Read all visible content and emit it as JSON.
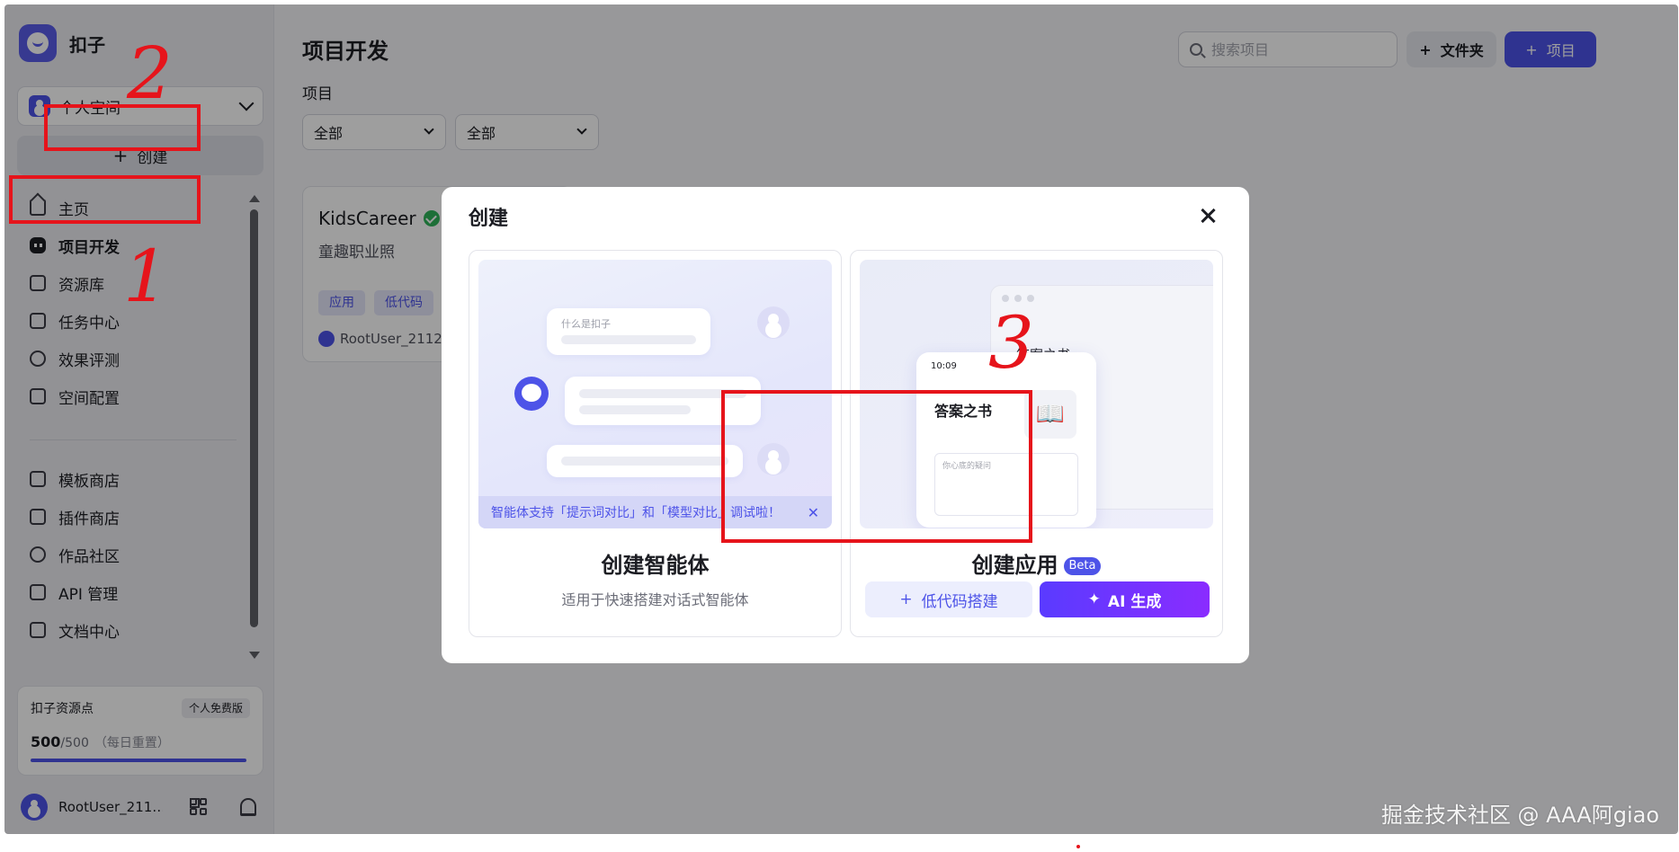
{
  "app": {
    "name": "扣子"
  },
  "sidebar": {
    "space_label": "个人空间",
    "create_label": "创建",
    "nav": [
      {
        "label": "主页",
        "icon": "home-icon"
      },
      {
        "label": "项目开发",
        "icon": "bot-icon"
      },
      {
        "label": "资源库",
        "icon": "library-icon"
      },
      {
        "label": "任务中心",
        "icon": "task-icon"
      },
      {
        "label": "效果评测",
        "icon": "gauge-icon"
      },
      {
        "label": "空间配置",
        "icon": "config-icon"
      },
      {
        "label": "模板商店",
        "icon": "template-icon"
      },
      {
        "label": "插件商店",
        "icon": "plugin-icon"
      },
      {
        "label": "作品社区",
        "icon": "community-icon"
      },
      {
        "label": "API 管理",
        "icon": "api-icon"
      },
      {
        "label": "文档中心",
        "icon": "doc-icon"
      }
    ],
    "points": {
      "title": "扣子资源点",
      "badge": "个人免费版",
      "value": "500",
      "max": "/500",
      "note": "（每日重置）",
      "fraction": 1.0
    },
    "user_name": "RootUser_211…"
  },
  "main": {
    "title": "项目开发",
    "search_placeholder": "搜索项目",
    "folder_btn": "文件夹",
    "project_btn": "项目",
    "section_label": "项目",
    "filters": [
      "全部",
      "全部"
    ],
    "card": {
      "name": "KidsCareer",
      "desc": "童趣职业照",
      "tags": [
        "应用",
        "低代码"
      ],
      "owner": "RootUser_2112"
    }
  },
  "modal": {
    "title": "创建",
    "agent": {
      "question": "什么是扣子",
      "notice": "智能体支持「提示词对比」和「模型对比」调试啦！",
      "title": "创建智能体",
      "subtitle": "适用于快速搭建对话式智能体"
    },
    "app": {
      "window_title": "答案之书",
      "phone_time": "10:09",
      "phone_title": "答案之书",
      "phone_placeholder": "你心底的疑问",
      "title": "创建应用",
      "badge": "Beta",
      "lowcode_btn": "低代码搭建",
      "ai_btn": "AI 生成"
    }
  },
  "annotations": {
    "mark1": "1",
    "mark2": "2",
    "mark3": "3"
  },
  "watermark": "掘金技术社区 @ AAA阿giao",
  "colors": {
    "accent": "#4d53e8",
    "annotation": "#e6141b",
    "ai_gradient_start": "#5a3bff",
    "ai_gradient_end": "#8a2cff"
  }
}
